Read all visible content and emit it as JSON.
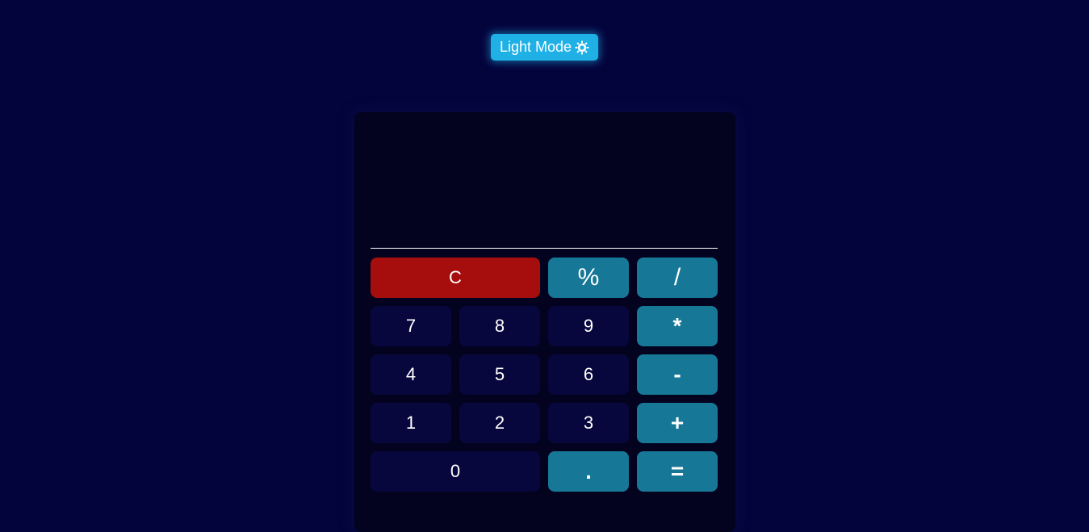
{
  "theme_toggle": {
    "label": "Light Mode",
    "icon": "sun-icon"
  },
  "display": {
    "value": ""
  },
  "keys": {
    "clear": "C",
    "percent": "%",
    "divide": "/",
    "seven": "7",
    "eight": "8",
    "nine": "9",
    "multiply": "*",
    "four": "4",
    "five": "5",
    "six": "6",
    "subtract": "-",
    "one": "1",
    "two": "2",
    "three": "3",
    "add": "+",
    "zero": "0",
    "decimal": ".",
    "equals": "="
  },
  "colors": {
    "background": "#04043d",
    "calculator_body": "#03031f",
    "number_key": "#07073e",
    "operator_key": "#167797",
    "clear_key": "#a60d0d",
    "toggle_button": "#1fb0e6"
  }
}
